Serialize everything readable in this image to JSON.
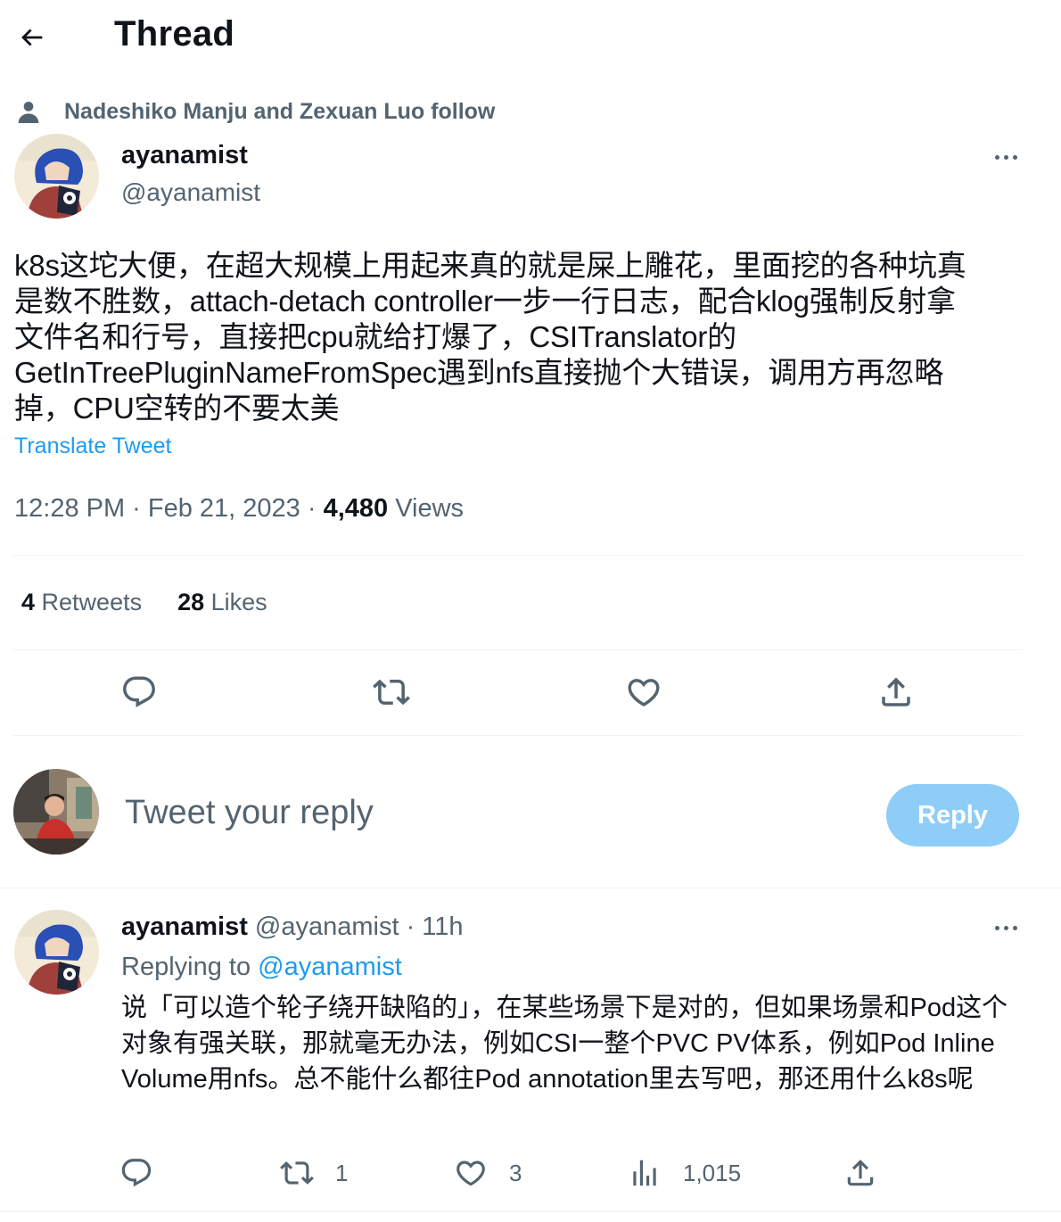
{
  "header": {
    "title": "Thread"
  },
  "social_context": "Nadeshiko Manju and Zexuan Luo follow",
  "tweet": {
    "display_name": "ayanamist",
    "handle": "@ayanamist",
    "text": "k8s这坨大便，在超大规模上用起来真的就是屎上雕花，里面挖的各种坑真\n是数不胜数，attach-detach controller一步一行日志，配合klog强制反射拿\n文件名和行号，直接把cpu就给打爆了，CSITranslator的\nGetInTreePluginNameFromSpec遇到nfs直接抛个大错误，调用方再忽略\n掉，CPU空转的不要太美",
    "translate_label": "Translate Tweet",
    "time": "12:28 PM · Feb 21, 2023 · ",
    "views_count": "4,480",
    "views_label": " Views",
    "retweets_count": "4",
    "retweets_label": " Retweets",
    "likes_count": "28",
    "likes_label": " Likes"
  },
  "composer": {
    "placeholder": "Tweet your reply",
    "button_label": "Reply"
  },
  "reply": {
    "display_name": "ayanamist",
    "handle_time": " @ayanamist · 11h",
    "replying_prefix": "Replying to ",
    "replying_to": "@ayanamist",
    "text": "说「可以造个轮子绕开缺陷的」，在某些场景下是对的，但如果场景和Pod这个对象有强关联，那就毫无办法，例如CSI一整个PVC PV体系，例如Pod Inline Volume用nfs。总不能什么都往Pod annotation里去写吧，那还用什么k8s呢",
    "retweet_count": "1",
    "like_count": "3",
    "views_count": "1,015"
  },
  "colors": {
    "text": "#0f1419",
    "secondary": "#536471",
    "accent": "#1d9bf0",
    "reply_button_disabled": "#8ecdf8",
    "divider": "#eff3f4"
  },
  "icons": [
    "back-arrow-icon",
    "person-icon",
    "more-icon",
    "reply-icon",
    "retweet-icon",
    "like-icon",
    "share-icon",
    "views-icon"
  ]
}
